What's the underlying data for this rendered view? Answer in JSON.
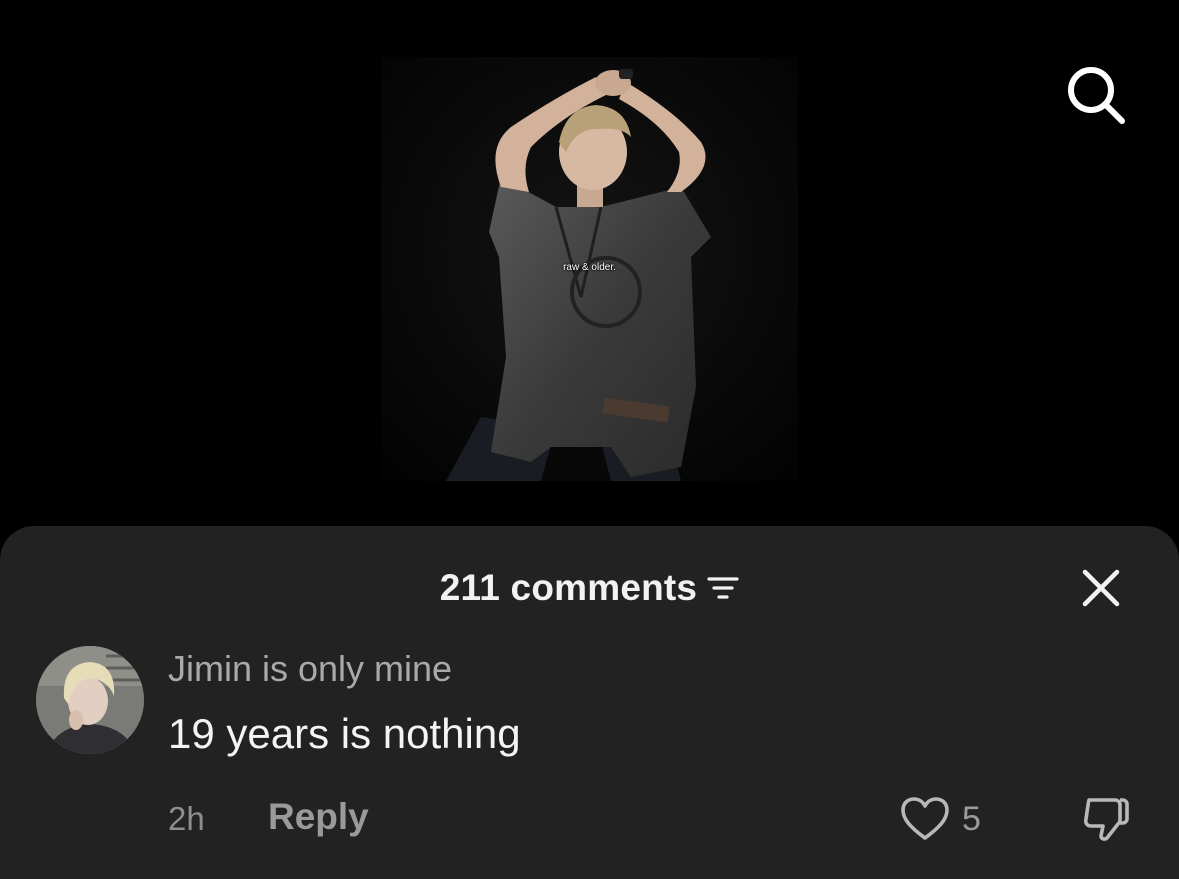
{
  "video": {
    "overlay_caption": "raw & older."
  },
  "toolbar": {
    "search_icon": "search-icon"
  },
  "comments_sheet": {
    "count_label": "211 comments",
    "sort_icon": "sort-filter-icon",
    "close_icon": "close-icon",
    "comment": {
      "username": "Jimin is only mine",
      "text": "19 years is nothing",
      "timestamp": "2h",
      "reply_label": "Reply",
      "like_icon": "heart-outline-icon",
      "like_count": "5",
      "dislike_icon": "thumbs-down-icon"
    }
  },
  "colors": {
    "background": "#000000",
    "sheet": "#222222",
    "primary_text": "#f2f2f2",
    "secondary_text": "#a9a9a9",
    "muted_text": "#8d8d8d"
  }
}
